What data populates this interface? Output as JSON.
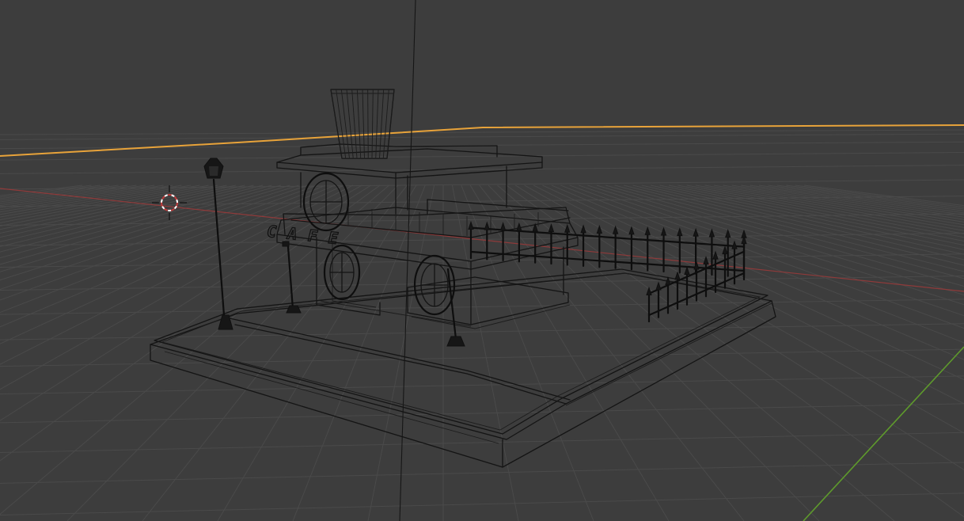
{
  "viewport": {
    "mode": "wireframe",
    "colors": {
      "background": "#3d3d3d",
      "grid": "#4a4a4a",
      "wire": "#141414",
      "horizon": "#e8a33a",
      "x_axis": "#9a3b3b",
      "y_axis": "#5e9a2c",
      "cursor_red": "#c23b3b",
      "cursor_white": "#ffffff"
    },
    "icons": [
      "3d-cursor-icon"
    ],
    "sign_text": "CAFE"
  }
}
